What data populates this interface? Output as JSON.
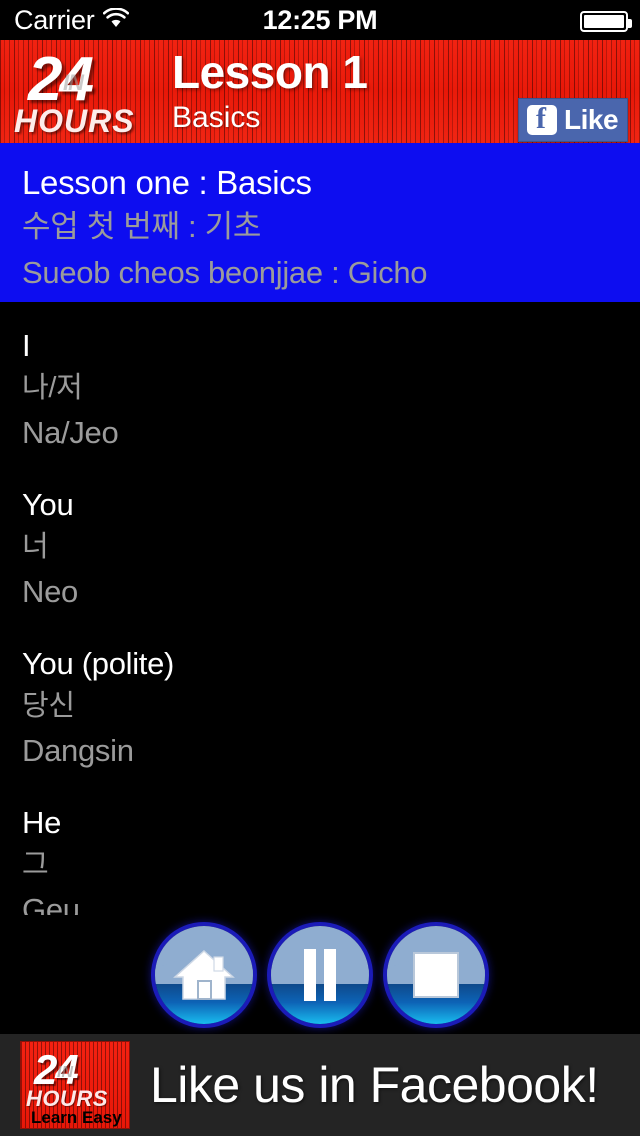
{
  "statusbar": {
    "carrier": "Carrier",
    "time": "12:25 PM",
    "wifi_icon": "wifi-icon",
    "battery_icon": "battery-icon"
  },
  "header": {
    "logo": {
      "number": "24",
      "watermark": "IN",
      "hours": "HOURS"
    },
    "title": "Lesson 1",
    "subtitle": "Basics",
    "facebook_like": {
      "label": "Like",
      "icon": "facebook-f-icon"
    },
    "background_color": "#e81708"
  },
  "banner": {
    "english": "Lesson one : Basics",
    "korean": "수업 첫 번째 : 기초",
    "romanized": "Sueob cheos beonjjae : Gicho",
    "background_color": "#0d0df0",
    "english_color": "#ffffff",
    "secondary_color": "#9b9b9b"
  },
  "lesson_entries": [
    {
      "english": "I",
      "korean": "나/저",
      "romanized": "Na/Jeo"
    },
    {
      "english": "You",
      "korean": "너",
      "romanized": "Neo"
    },
    {
      "english": "You (polite)",
      "korean": "당신",
      "romanized": "Dangsin"
    },
    {
      "english": "He",
      "korean": "그",
      "romanized": "Geu"
    }
  ],
  "controls": [
    {
      "name": "home",
      "icon": "home-icon",
      "label": "Home"
    },
    {
      "name": "pause",
      "icon": "pause-icon",
      "label": "Pause"
    },
    {
      "name": "stop",
      "icon": "stop-icon",
      "label": "Stop"
    }
  ],
  "ad_banner": {
    "logo": {
      "number": "24",
      "watermark": "IN",
      "hours": "HOURS",
      "tagline": "Learn Easy"
    },
    "text": "Like us in Facebook!",
    "background_color": "#242424"
  }
}
